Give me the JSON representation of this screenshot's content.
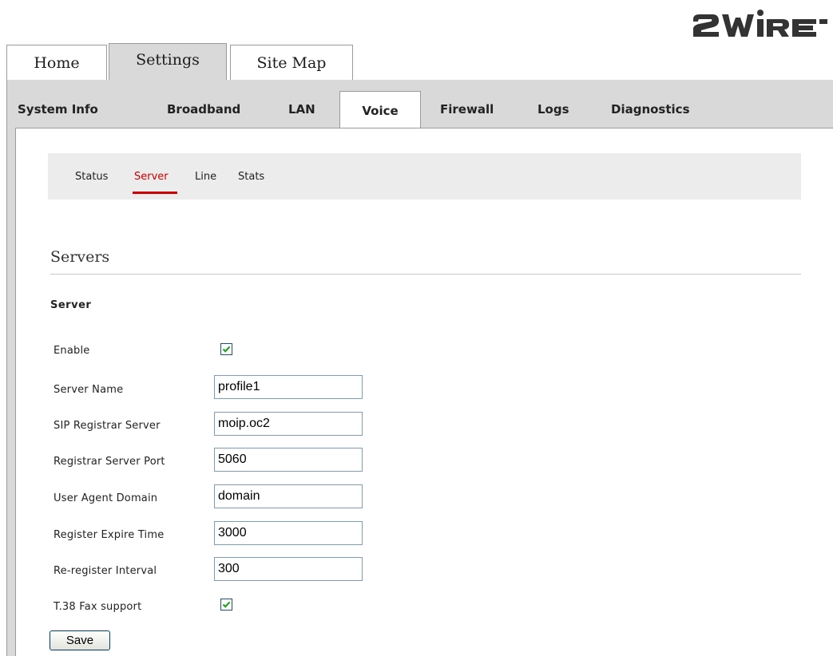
{
  "brand": {
    "logo_text": "2WIRE",
    "logo_color": "#333333"
  },
  "top_tabs": [
    {
      "label": "Home"
    },
    {
      "label": "Settings",
      "active": true
    },
    {
      "label": "Site Map"
    }
  ],
  "sub_tabs": [
    {
      "label": "System Info"
    },
    {
      "label": "Broadband"
    },
    {
      "label": "LAN"
    },
    {
      "label": "Voice",
      "active": true
    },
    {
      "label": "Firewall"
    },
    {
      "label": "Logs"
    },
    {
      "label": "Diagnostics"
    }
  ],
  "voice_nav": [
    {
      "label": "Status"
    },
    {
      "label": "Server",
      "active": true
    },
    {
      "label": "Line"
    },
    {
      "label": "Stats"
    }
  ],
  "page": {
    "section_title": "Servers",
    "subsection_title": "Server"
  },
  "form": {
    "enable_label": "Enable",
    "enable_checked": true,
    "server_name_label": "Server Name",
    "server_name_value": "profile1",
    "sip_registrar_label": "SIP Registrar Server",
    "sip_registrar_value": "moip.oc2",
    "registrar_port_label": "Registrar Server Port",
    "registrar_port_value": "5060",
    "user_agent_domain_label": "User Agent Domain",
    "user_agent_domain_value": "domain",
    "register_expire_label": "Register Expire Time",
    "register_expire_value": "3000",
    "reregister_interval_label": "Re-register Interval",
    "reregister_interval_value": "300",
    "fax_label": "T.38 Fax support",
    "fax_checked": true,
    "save_label": "Save"
  },
  "colors": {
    "accent_red": "#cc0000",
    "tab_grey": "#d9d9d9",
    "check_green": "#21a121"
  }
}
